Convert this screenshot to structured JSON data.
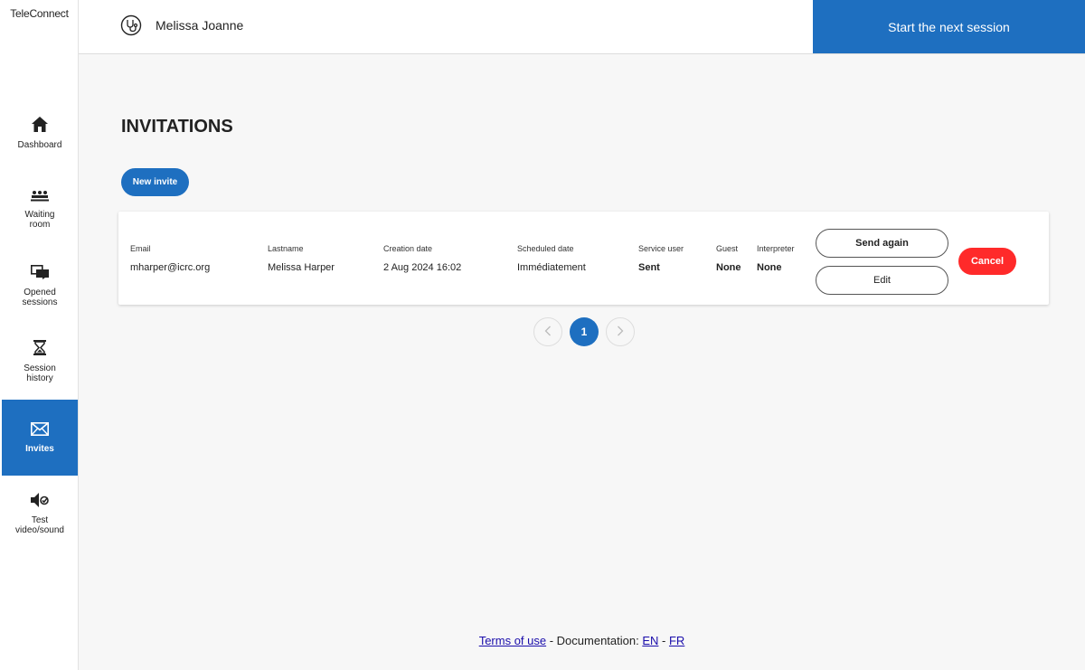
{
  "app": {
    "name": "TeleConnect"
  },
  "sidebar": {
    "items": [
      {
        "label": "Dashboard",
        "icon": "home-icon",
        "active": false
      },
      {
        "label": "Waiting\nroom",
        "icon": "waiting-room-icon",
        "active": false
      },
      {
        "label": "Opened\nsessions",
        "icon": "chat-icon",
        "active": false
      },
      {
        "label": "Session\nhistory",
        "icon": "hourglass-icon",
        "active": false
      },
      {
        "label": "Invites",
        "icon": "envelope-icon",
        "active": true
      },
      {
        "label": "Test\nvideo/sound",
        "icon": "speaker-check-icon",
        "active": false
      }
    ]
  },
  "header": {
    "user_name": "Melissa Joanne",
    "user_icon": "stethoscope-icon",
    "start_button": "Start the next session"
  },
  "main": {
    "title": "INVITATIONS",
    "new_invite_button": "New invite",
    "columns": {
      "email": "Email",
      "lastname": "Lastname",
      "creation_date": "Creation date",
      "scheduled_date": "Scheduled date",
      "service_user": "Service user",
      "guest": "Guest",
      "interpreter": "Interpreter"
    },
    "invites": [
      {
        "email": "mharper@icrc.org",
        "lastname": "Melissa Harper",
        "creation_date": "2 Aug 2024 16:02",
        "scheduled_date": "Immédiatement",
        "service_user": "Sent",
        "guest": "None",
        "interpreter": "None",
        "send_again_button": "Send again",
        "edit_button": "Edit",
        "cancel_button": "Cancel"
      }
    ],
    "pagination": {
      "current_page": "1",
      "prev_icon": "chevron-left-icon",
      "next_icon": "chevron-right-icon"
    }
  },
  "footer": {
    "terms_link": "Terms of use",
    "separator": " - Documentation: ",
    "en_link": "EN",
    "dash": " - ",
    "fr_link": "FR"
  },
  "colors": {
    "primary": "#1e6fc0",
    "danger": "#ff2a2a",
    "background": "#f7f7f7"
  }
}
